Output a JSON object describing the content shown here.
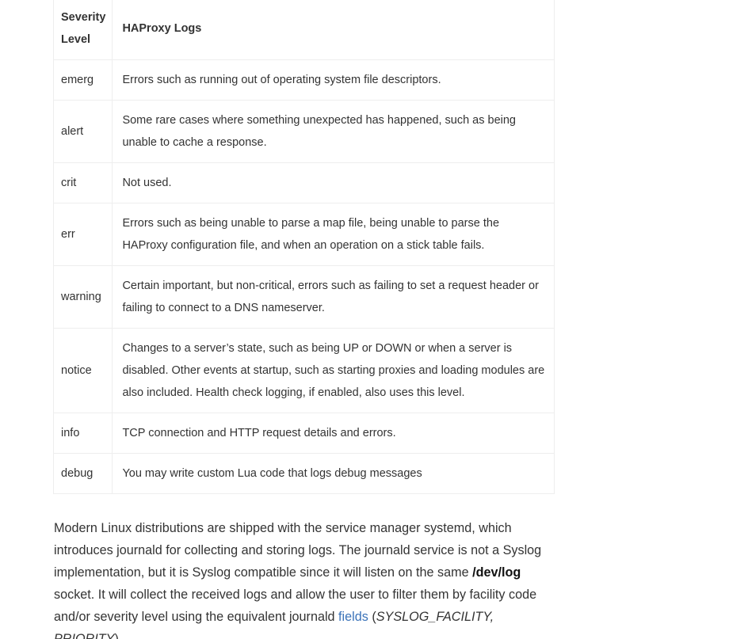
{
  "table": {
    "headers": [
      "Severity Level",
      "HAProxy Logs"
    ],
    "rows": [
      {
        "level": "emerg",
        "desc": "Errors such as running out of operating system file descriptors."
      },
      {
        "level": "alert",
        "desc": "Some rare cases where something unexpected has happened, such as being unable to cache a response."
      },
      {
        "level": "crit",
        "desc": "Not used."
      },
      {
        "level": "err",
        "desc": "Errors such as being unable to parse a map file, being unable to parse the HAProxy configuration file, and when an operation on a stick table fails."
      },
      {
        "level": "warning",
        "desc": "Certain important, but non-critical, errors such as failing to set a request header or failing to connect to a DNS nameserver."
      },
      {
        "level": "notice",
        "desc": "Changes to a server’s state, such as being UP or DOWN or when a server is disabled. Other events at startup, such as starting proxies and loading modules are also included. Health check logging, if enabled, also uses this level."
      },
      {
        "level": "info",
        "desc": "TCP connection and HTTP request details and errors."
      },
      {
        "level": "debug",
        "desc": "You may write custom Lua code that logs debug messages"
      }
    ]
  },
  "paragraph": {
    "text_1": "Modern Linux distributions are shipped with the service manager systemd, which introduces journald for collecting and storing logs. The journald service is not a Syslog implementation, but it is Syslog compatible since it will listen on the same ",
    "bold": "/dev/log",
    "text_2": " socket. It will collect the received logs and allow the user to filter them by facility code and/or severity level using the equivalent journald ",
    "link": "fields",
    "text_3": " (",
    "italic": "SYSLOG_FACILITY, PRIORITY",
    "text_4": ")."
  },
  "colors": {
    "link": "#3b73b9",
    "border": "#eeeeee",
    "text": "#333333"
  }
}
